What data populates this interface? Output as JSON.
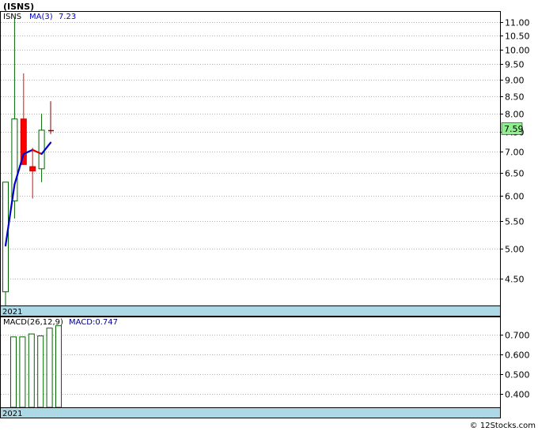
{
  "title": "(ISNS)",
  "watermark": "© 12Stocks.com",
  "chart_data": [
    {
      "type": "candlestick",
      "ticker_label": "ISNS",
      "ma_label": "MA(3)",
      "ma_value_label": "7.23",
      "last_price_label": "7.59",
      "last_price": 7.59,
      "x_label": "2021",
      "ylim": [
        4.1,
        11.4
      ],
      "yticks": [
        4.5,
        5.0,
        5.5,
        6.0,
        6.5,
        7.0,
        7.5,
        8.0,
        8.5,
        9.0,
        9.5,
        10.0,
        10.5,
        11.0
      ],
      "ytick_labels": [
        "4.50",
        "5.00",
        "5.50",
        "6.00",
        "6.50",
        "7.00",
        "7.50",
        "8.00",
        "8.50",
        "9.00",
        "9.50",
        "10.00",
        "10.50",
        "11.00"
      ],
      "grid": true,
      "candles": [
        {
          "open": 4.3,
          "high": 6.3,
          "low": 4.1,
          "close": 6.3
        },
        {
          "open": 5.9,
          "high": 11.15,
          "low": 5.55,
          "close": 7.85
        },
        {
          "open": 7.85,
          "high": 9.2,
          "low": 6.7,
          "close": 6.7
        },
        {
          "open": 6.65,
          "high": 7.1,
          "low": 5.95,
          "close": 6.55
        },
        {
          "open": 6.6,
          "high": 8.0,
          "low": 6.3,
          "close": 7.55
        },
        {
          "open": 7.6,
          "high": 8.35,
          "low": 7.45,
          "close": 7.55
        }
      ],
      "ma": [
        5.05,
        6.25,
        6.95,
        7.05,
        6.95,
        7.23
      ],
      "colors": {
        "up": "#006400",
        "down": "#ff0000",
        "ma": "#0000cc",
        "last_price_bg": "#90ee90"
      }
    },
    {
      "type": "bar",
      "label": "MACD(26,12,9)",
      "value_label": "MACD:0.747",
      "x_label": "2021",
      "ylim": [
        0.33,
        0.79
      ],
      "yticks": [
        0.4,
        0.5,
        0.6,
        0.7
      ],
      "ytick_labels": [
        "0.400",
        "0.500",
        "0.600",
        "0.700"
      ],
      "grid": true,
      "values": [
        0.69,
        0.69,
        0.705,
        0.695,
        0.735,
        0.747
      ],
      "colors": {
        "bar": "#006400",
        "label": "#000080"
      }
    }
  ]
}
